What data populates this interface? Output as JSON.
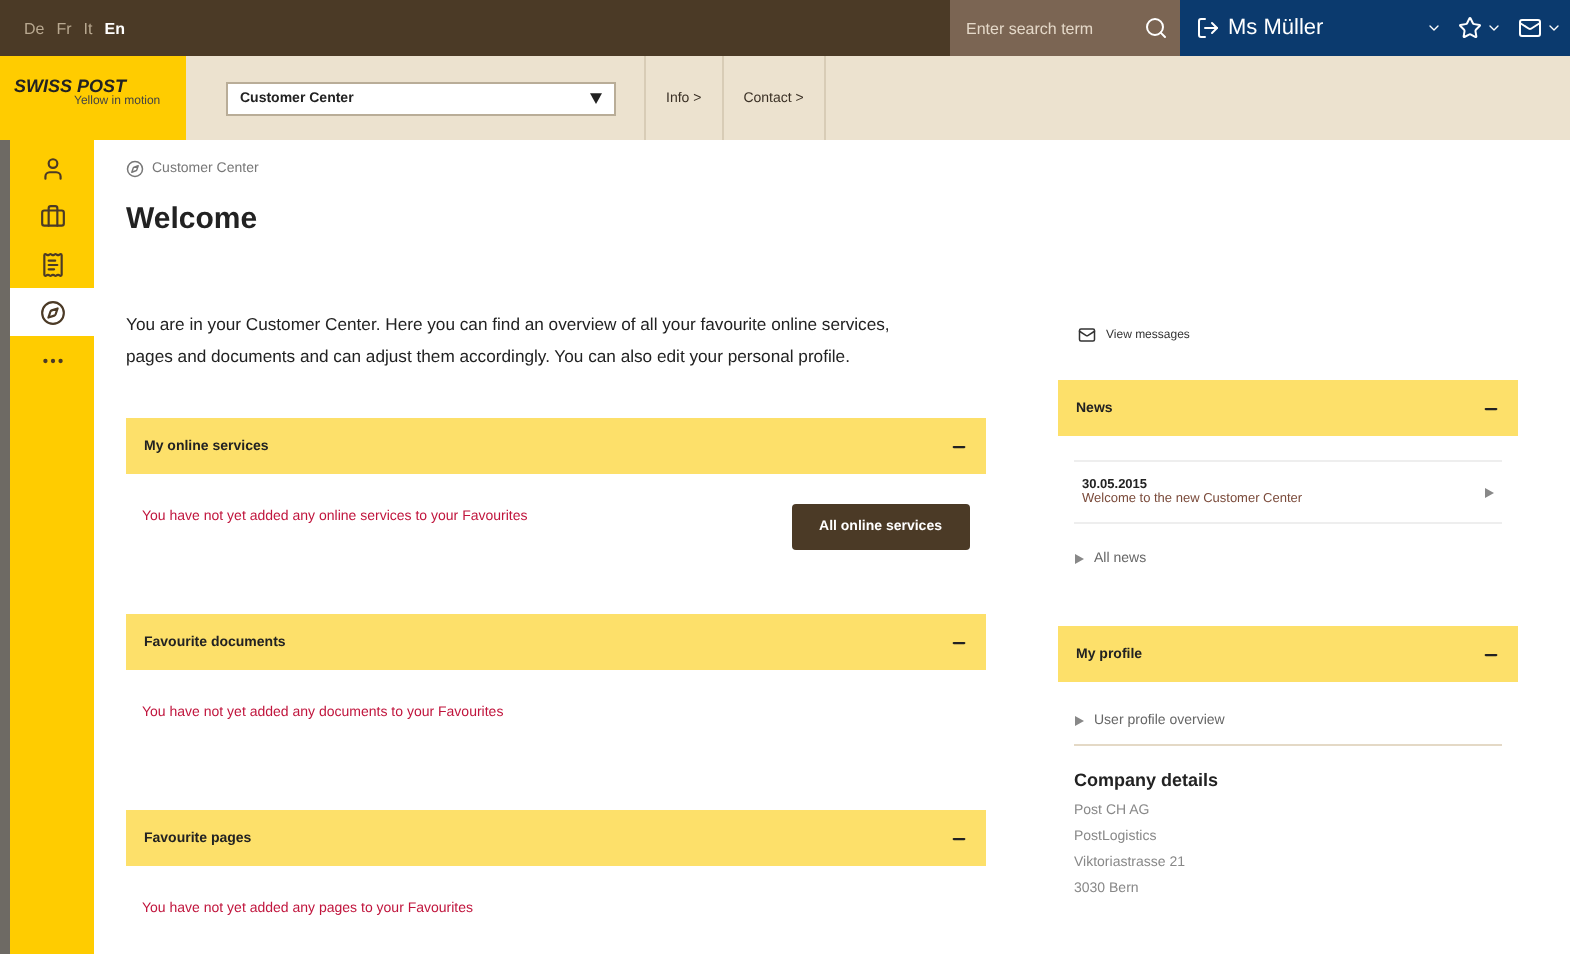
{
  "languages": [
    {
      "label": "De",
      "selected": false
    },
    {
      "label": "Fr",
      "selected": false
    },
    {
      "label": "It",
      "selected": false
    },
    {
      "label": "En",
      "selected": true
    }
  ],
  "search": {
    "placeholder": "Enter search term"
  },
  "user": {
    "name": "Ms Müller"
  },
  "logo": {
    "name": "SWISS POST",
    "tagline": "Yellow in motion"
  },
  "portal_select": {
    "value": "Customer Center"
  },
  "nav_links": [
    "Info >",
    "Contact >"
  ],
  "sidebar": [
    {
      "kind": "person",
      "selected": false
    },
    {
      "kind": "briefcase",
      "selected": false
    },
    {
      "kind": "document",
      "selected": false
    },
    {
      "kind": "compass",
      "selected": true
    },
    {
      "kind": "more",
      "selected": false
    }
  ],
  "breadcrumb": "Customer Center",
  "title": "Welcome",
  "intro": "You are in your Customer Center. Here you can find an overview of all your favourite online services, pages and documents and can adjust them accordingly. You can also edit your personal profile.",
  "sections": [
    {
      "title": "My online services",
      "expanded": true,
      "message": "You have not yet added any online services to your Favourites",
      "button": "All online services"
    },
    {
      "title": "Favourite documents",
      "expanded": true,
      "message": "You have not yet added any documents to your Favourites"
    },
    {
      "title": "Favourite pages",
      "expanded": true,
      "message": "You have not yet added any pages to your Favourites"
    }
  ],
  "messages_link": "View messages",
  "news": {
    "title": "News",
    "expanded": true,
    "items": [
      {
        "date": "30.05.2015",
        "text": "Welcome to the new Customer Center"
      }
    ],
    "all_link": "All news"
  },
  "profile": {
    "title": "My profile",
    "expanded": true,
    "link": "User profile overview",
    "company_title": "Company details",
    "address": [
      "Post CH AG",
      "PostLogistics",
      "Viktoriastrasse 21",
      "3030 Bern"
    ]
  }
}
